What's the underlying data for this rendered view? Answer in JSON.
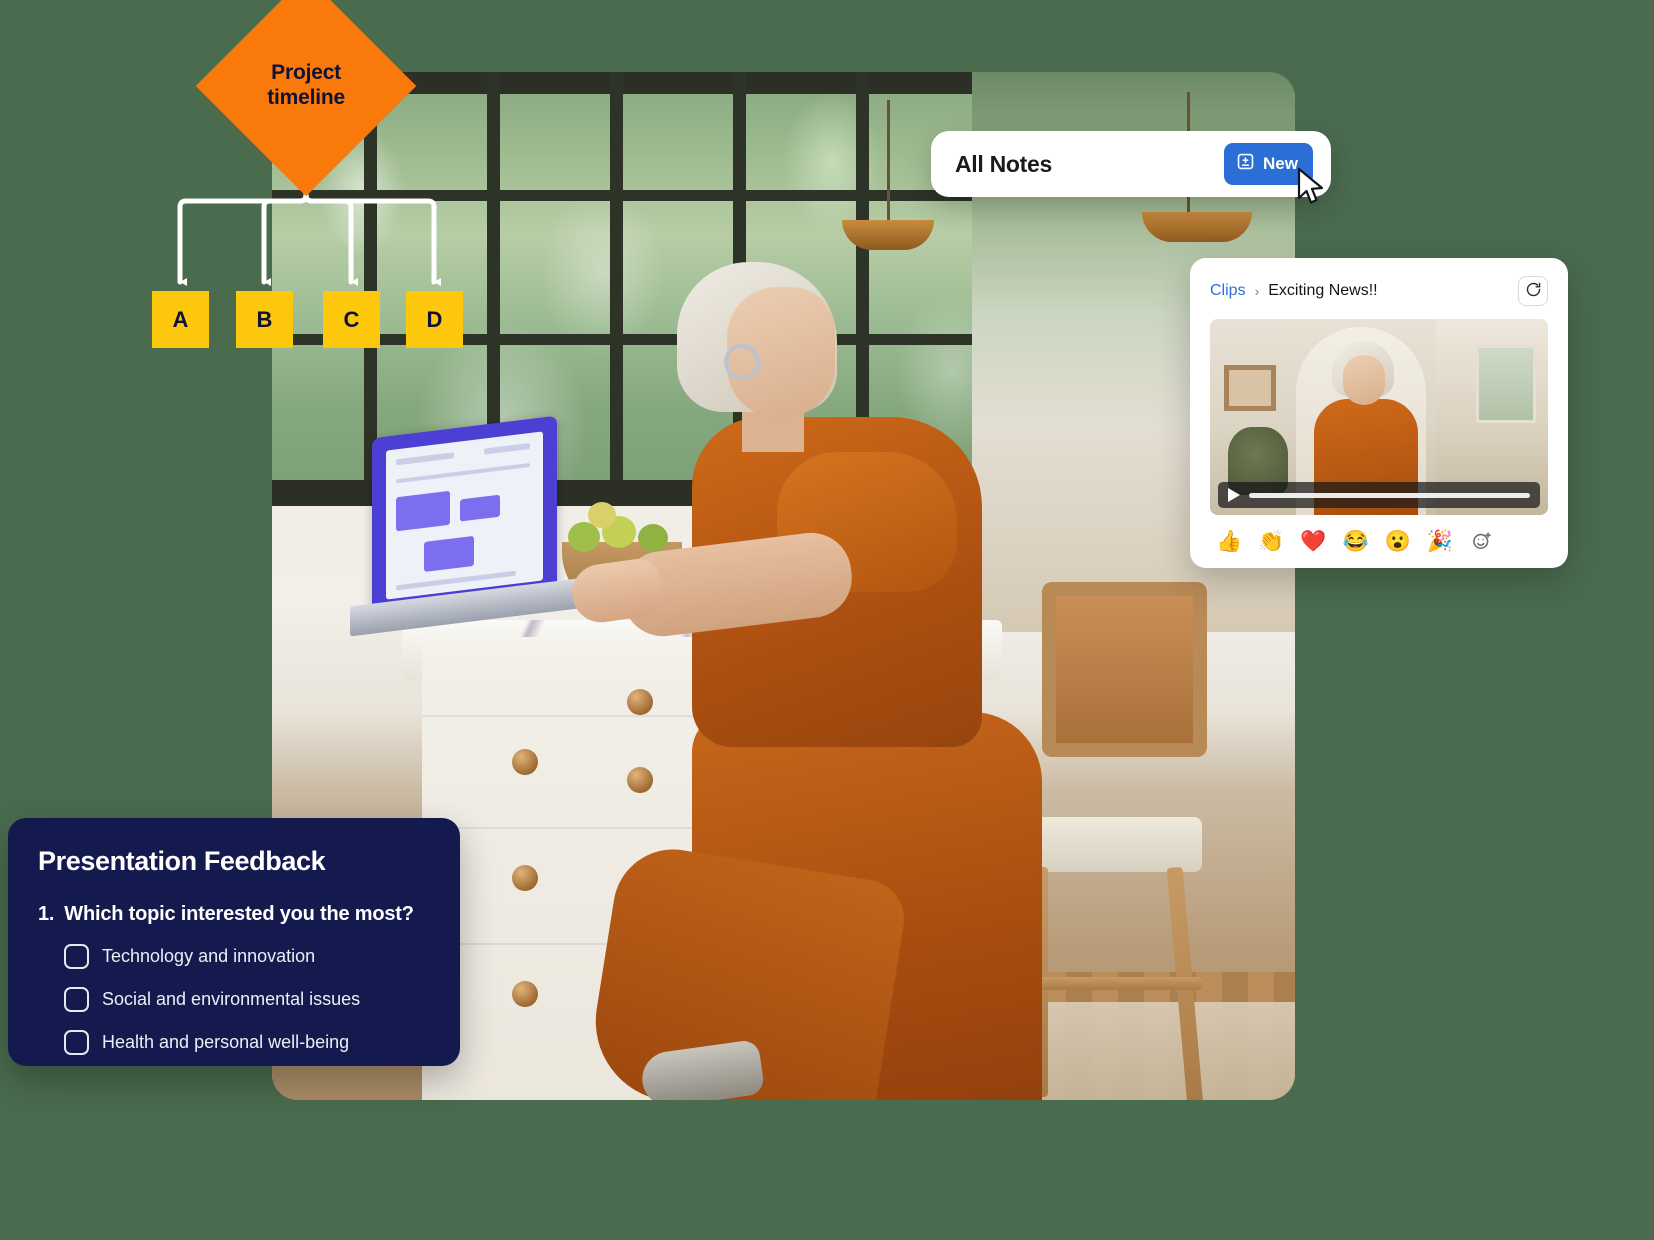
{
  "flowchart": {
    "root_label": "Project\ntimeline",
    "root_line1": "Project",
    "root_line2": "timeline",
    "root_color": "#F97A0B",
    "node_color": "#FDC70B",
    "nodes": [
      {
        "label": "A"
      },
      {
        "label": "B"
      },
      {
        "label": "C"
      },
      {
        "label": "D"
      }
    ]
  },
  "notes_card": {
    "title": "All Notes",
    "new_button_label": "New",
    "new_button_icon": "note-plus-icon",
    "accent_color": "#2B6FD6"
  },
  "cursor": {
    "icon": "mouse-pointer-icon"
  },
  "clips_card": {
    "breadcrumb": {
      "parent": "Clips",
      "separator": "›",
      "current": "Exciting News!!"
    },
    "refresh_icon": "refresh-icon",
    "link_color": "#2B6FD6",
    "video": {
      "play_icon": "play-icon",
      "progress_percent": 0
    },
    "reactions": [
      {
        "name": "thumbs-up",
        "glyph": "👍"
      },
      {
        "name": "clap",
        "glyph": "👏"
      },
      {
        "name": "heart",
        "glyph": "❤️"
      },
      {
        "name": "joy",
        "glyph": "😂"
      },
      {
        "name": "astonished",
        "glyph": "😮"
      },
      {
        "name": "party-popper",
        "glyph": "🎉"
      }
    ],
    "add_reaction_glyph": "☺"
  },
  "feedback_card": {
    "title": "Presentation Feedback",
    "question_number": "1.",
    "question": "Which topic interested you the most?",
    "background": "#141A4E",
    "options": [
      {
        "label": "Technology and innovation",
        "checked": false
      },
      {
        "label": "Social and environmental issues",
        "checked": false
      },
      {
        "label": "Health and personal well-being",
        "checked": false
      }
    ]
  }
}
